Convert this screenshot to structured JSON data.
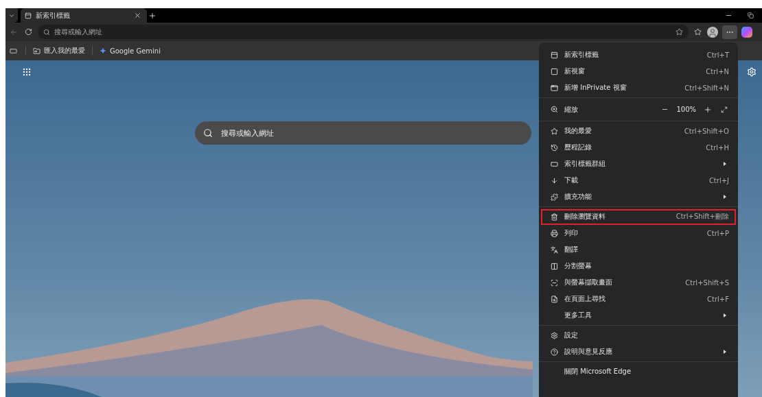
{
  "tab": {
    "title": "新索引標籤",
    "selected": true
  },
  "address_bar": {
    "placeholder": "搜尋或輸入網址"
  },
  "bookmarks": [
    {
      "label": "匯入我的最愛"
    },
    {
      "label": "Google Gemini"
    }
  ],
  "new_tab_page": {
    "search": {
      "placeholder": "搜尋或輸入網址"
    }
  },
  "menu": {
    "sections": [
      {
        "items": [
          {
            "kind": "item",
            "label": "新索引標籤",
            "shortcut": "Ctrl+T",
            "submenu": false,
            "highlighted": false
          },
          {
            "kind": "item",
            "label": "新視窗",
            "shortcut": "Ctrl+N",
            "submenu": false,
            "highlighted": false
          },
          {
            "kind": "item",
            "label": "新增 InPrivate 視窗",
            "shortcut": "Ctrl+Shift+N",
            "submenu": false,
            "highlighted": false
          }
        ]
      },
      {
        "items": [
          {
            "kind": "zoom",
            "label": "縮放",
            "value": "100%"
          }
        ]
      },
      {
        "items": [
          {
            "kind": "item",
            "label": "我的最愛",
            "shortcut": "Ctrl+Shift+O",
            "submenu": false,
            "highlighted": false
          },
          {
            "kind": "item",
            "label": "歷程記錄",
            "shortcut": "Ctrl+H",
            "submenu": false,
            "highlighted": false
          },
          {
            "kind": "item",
            "label": "索引標籤群組",
            "submenu": true,
            "highlighted": false
          },
          {
            "kind": "item",
            "label": "下載",
            "shortcut": "Ctrl+J",
            "submenu": false,
            "highlighted": false
          },
          {
            "kind": "item",
            "label": "擴充功能",
            "submenu": true,
            "highlighted": false
          }
        ]
      },
      {
        "items": [
          {
            "kind": "item",
            "label": "刪除瀏覽資料",
            "shortcut": "Ctrl+Shift+刪除",
            "submenu": false,
            "highlighted": true
          },
          {
            "kind": "item",
            "label": "列印",
            "shortcut": "Ctrl+P",
            "submenu": false,
            "highlighted": false
          },
          {
            "kind": "item",
            "label": "翻譯",
            "submenu": false,
            "highlighted": false
          },
          {
            "kind": "item",
            "label": "分割螢幕",
            "submenu": false,
            "highlighted": false
          },
          {
            "kind": "item",
            "label": "與螢幕擷取畫面",
            "shortcut": "Ctrl+Shift+S",
            "submenu": false,
            "highlighted": false
          },
          {
            "kind": "item",
            "label": "在頁面上尋找",
            "shortcut": "Ctrl+F",
            "submenu": false,
            "highlighted": false
          },
          {
            "kind": "item",
            "label": "更多工具",
            "submenu": true,
            "highlighted": false
          }
        ]
      },
      {
        "items": [
          {
            "kind": "item",
            "label": "設定",
            "submenu": false,
            "highlighted": false
          },
          {
            "kind": "item",
            "label": "說明與意見反應",
            "submenu": true,
            "highlighted": false
          }
        ]
      },
      {
        "items": [
          {
            "kind": "item",
            "label": "關閉 Microsoft Edge",
            "submenu": false,
            "highlighted": false
          }
        ]
      }
    ]
  }
}
